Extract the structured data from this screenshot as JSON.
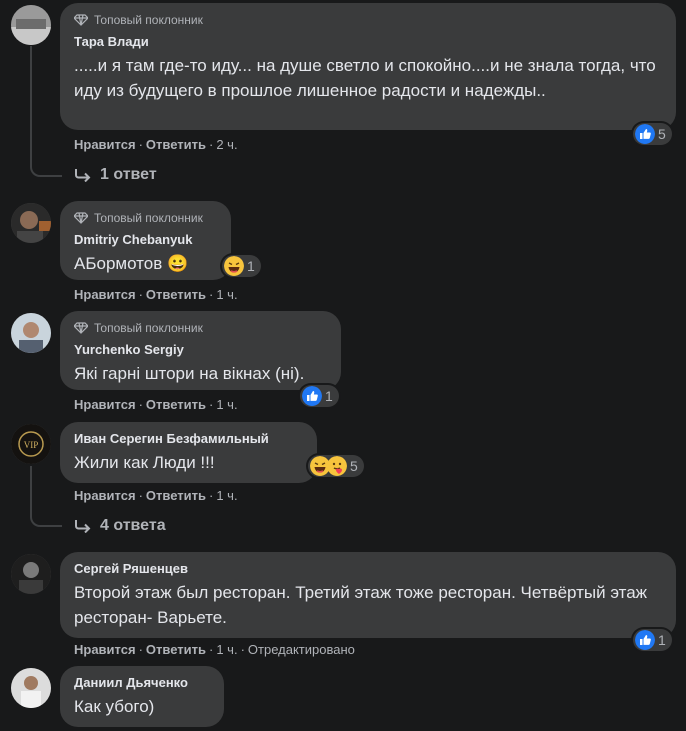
{
  "top_fan_label": "Топовый поклонник",
  "like_label": "Нравится",
  "reply_label": "Ответить",
  "colors": {
    "background": "#18191a",
    "bubble": "#3a3b3c",
    "like_blue": "#2078f4",
    "haha_yellow": "#f7c43d"
  },
  "comments": [
    {
      "author": "Тара Влади",
      "top_fan": true,
      "text": ".....и я там где-то иду... на душе светло и спокойно....и не знала тогда, что иду из будущего в прошлое лишенное радости и надежды..",
      "time": "2 ч.",
      "reactions": {
        "icons": [
          "like-icon"
        ],
        "count": "5"
      },
      "replies": "1 ответ"
    },
    {
      "author": "Dmitriy Chebanyuk",
      "top_fan": true,
      "text": "АБормотов 😀",
      "time": "1 ч.",
      "reactions": {
        "icons": [
          "haha-icon"
        ],
        "count": "1"
      }
    },
    {
      "author": "Yurchenko Sergiy",
      "top_fan": true,
      "text": "Які гарні штори на вікнах (ні).",
      "time": "1 ч.",
      "reactions": {
        "icons": [
          "like-icon"
        ],
        "count": "1"
      }
    },
    {
      "author": "Иван Серегин Безфамильный",
      "top_fan": false,
      "text": "Жили как Люди !!!",
      "time": "1 ч.",
      "reactions": {
        "icons": [
          "haha-icon",
          "care-icon"
        ],
        "count": "5"
      },
      "replies": "4 ответа"
    },
    {
      "author": "Сергей Ряшенцев",
      "top_fan": false,
      "text": "Второй этаж был ресторан. Третий этаж тоже ресторан. Четвёртый этаж ресторан- Варьете.",
      "time": "1 ч.",
      "edited": "Отредактировано",
      "reactions": {
        "icons": [
          "like-icon"
        ],
        "count": "1"
      }
    },
    {
      "author": "Даниил Дьяченко",
      "top_fan": false,
      "text": "Как убого)"
    }
  ]
}
